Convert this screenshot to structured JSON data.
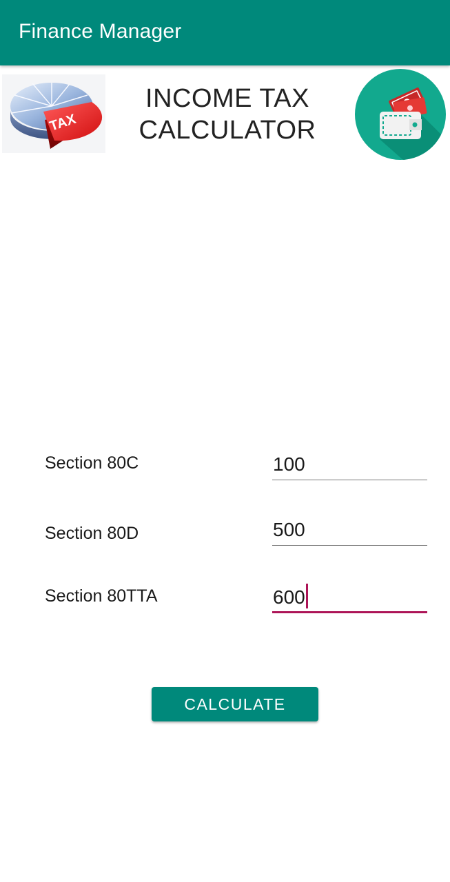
{
  "app_bar": {
    "title": "Finance Manager",
    "color": "#00897b"
  },
  "header": {
    "title_line1": "INCOME TAX",
    "title_line2": "CALCULATOR",
    "left_logo": "tax-pie-chart-icon",
    "left_logo_text": "TAX",
    "right_logo": "wallet-icon"
  },
  "form": {
    "rows": [
      {
        "label": "Section 80C",
        "value": "100",
        "focused": false
      },
      {
        "label": "Section 80D",
        "value": "500",
        "focused": false
      },
      {
        "label": "Section 80TTA",
        "value": "600",
        "focused": true
      }
    ],
    "focus_color": "#ad1457"
  },
  "calculate_button": {
    "label": "CALCULATE"
  }
}
